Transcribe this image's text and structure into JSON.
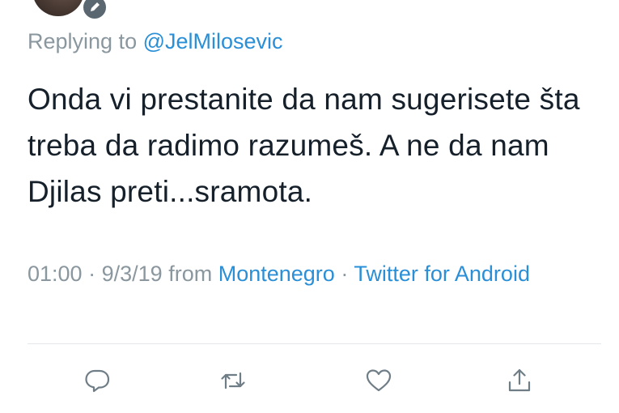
{
  "reply": {
    "prefix": "Replying to",
    "mention": "@JelMilosevic"
  },
  "tweet": {
    "text": "Onda vi prestanite da nam sugerisete šta treba da radimo razumeš. A ne da nam Djilas preti...sramota."
  },
  "meta": {
    "time": "01:00",
    "separator1": "·",
    "date": "9/3/19",
    "from_label": "from",
    "location": "Montenegro",
    "separator2": "·",
    "client": "Twitter for Android"
  },
  "actions": [
    {
      "name": "reply-icon"
    },
    {
      "name": "retweet-icon"
    },
    {
      "name": "like-icon"
    },
    {
      "name": "share-icon"
    }
  ],
  "colors": {
    "link": "#2a8fd6",
    "muted": "#8a979f",
    "text": "#15202b",
    "icon": "#6f7d86"
  }
}
